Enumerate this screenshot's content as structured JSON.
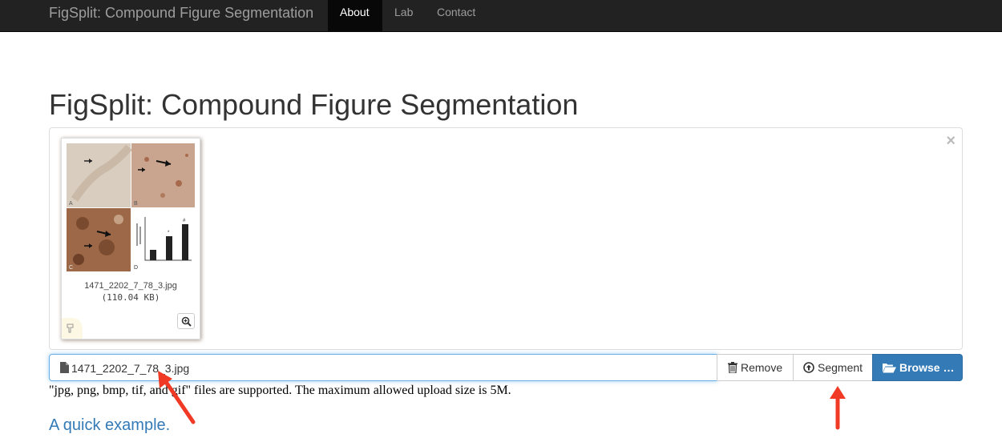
{
  "navbar": {
    "brand": "FigSplit: Compound Figure Segmentation",
    "items": [
      {
        "label": "About",
        "active": true
      },
      {
        "label": "Lab",
        "active": false
      },
      {
        "label": "Contact",
        "active": false
      }
    ]
  },
  "page_title": "FigSplit: Compound Figure Segmentation",
  "preview": {
    "close_symbol": "×",
    "file_name": "1471_2202_7_78_3.jpg",
    "file_size": "(110.04 KB)",
    "panel_letters": [
      "A",
      "B",
      "C",
      "D"
    ],
    "chart_marks": [
      "#",
      "*"
    ]
  },
  "file_input": {
    "caption": "1471_2202_7_78_3.jpg",
    "remove_label": "Remove",
    "segment_label": "Segment",
    "browse_label": "Browse …"
  },
  "help_text": "\"jpg, png, bmp, tif, and gif\" files are supported. The maximum allowed upload size is 5M.",
  "example_link": "A quick example.",
  "colors": {
    "navbar_bg": "#222222",
    "primary": "#337ab7",
    "annotation_arrow": "#f03a26"
  },
  "icons": [
    "file-icon",
    "trash-icon",
    "upload-circle-icon",
    "folder-open-icon",
    "zoom-in-icon",
    "drag-hand-icon",
    "close-icon"
  ]
}
